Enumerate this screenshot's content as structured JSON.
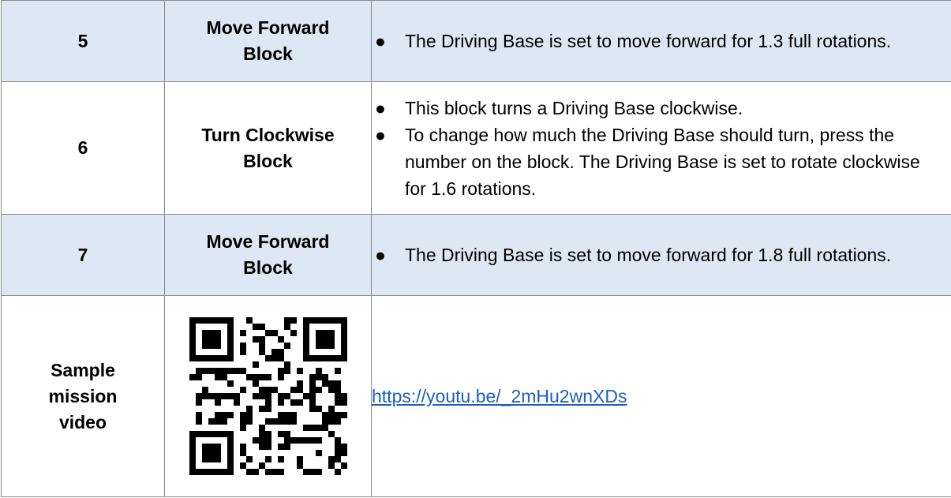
{
  "rows": [
    {
      "number": "5",
      "block_line1": "Move Forward",
      "block_line2": "Block",
      "bullets": [
        "The Driving Base is set to move forward for 1.3 full rotations."
      ]
    },
    {
      "number": "6",
      "block_line1": "Turn Clockwise",
      "block_line2": "Block",
      "bullets": [
        "This block turns a Driving Base clockwise.",
        "To change how much the Driving Base should turn, press the number on the block. The Driving Base is set to rotate clockwise for 1.6 rotations."
      ]
    },
    {
      "number": "7",
      "block_line1": "Move Forward",
      "block_line2": "Block",
      "bullets": [
        "The Driving Base is set to move forward for 1.8 full rotations."
      ]
    }
  ],
  "sample": {
    "label_line1": "Sample",
    "label_line2": "mission",
    "label_line3": "video",
    "link_text": "https://youtu.be/_2mHu2wnXDs"
  },
  "colors": {
    "shaded_row": "#dde8f4",
    "link": "#1f5fbf",
    "border": "#8a8a8a"
  },
  "icons": {
    "qr": "qr-code"
  }
}
